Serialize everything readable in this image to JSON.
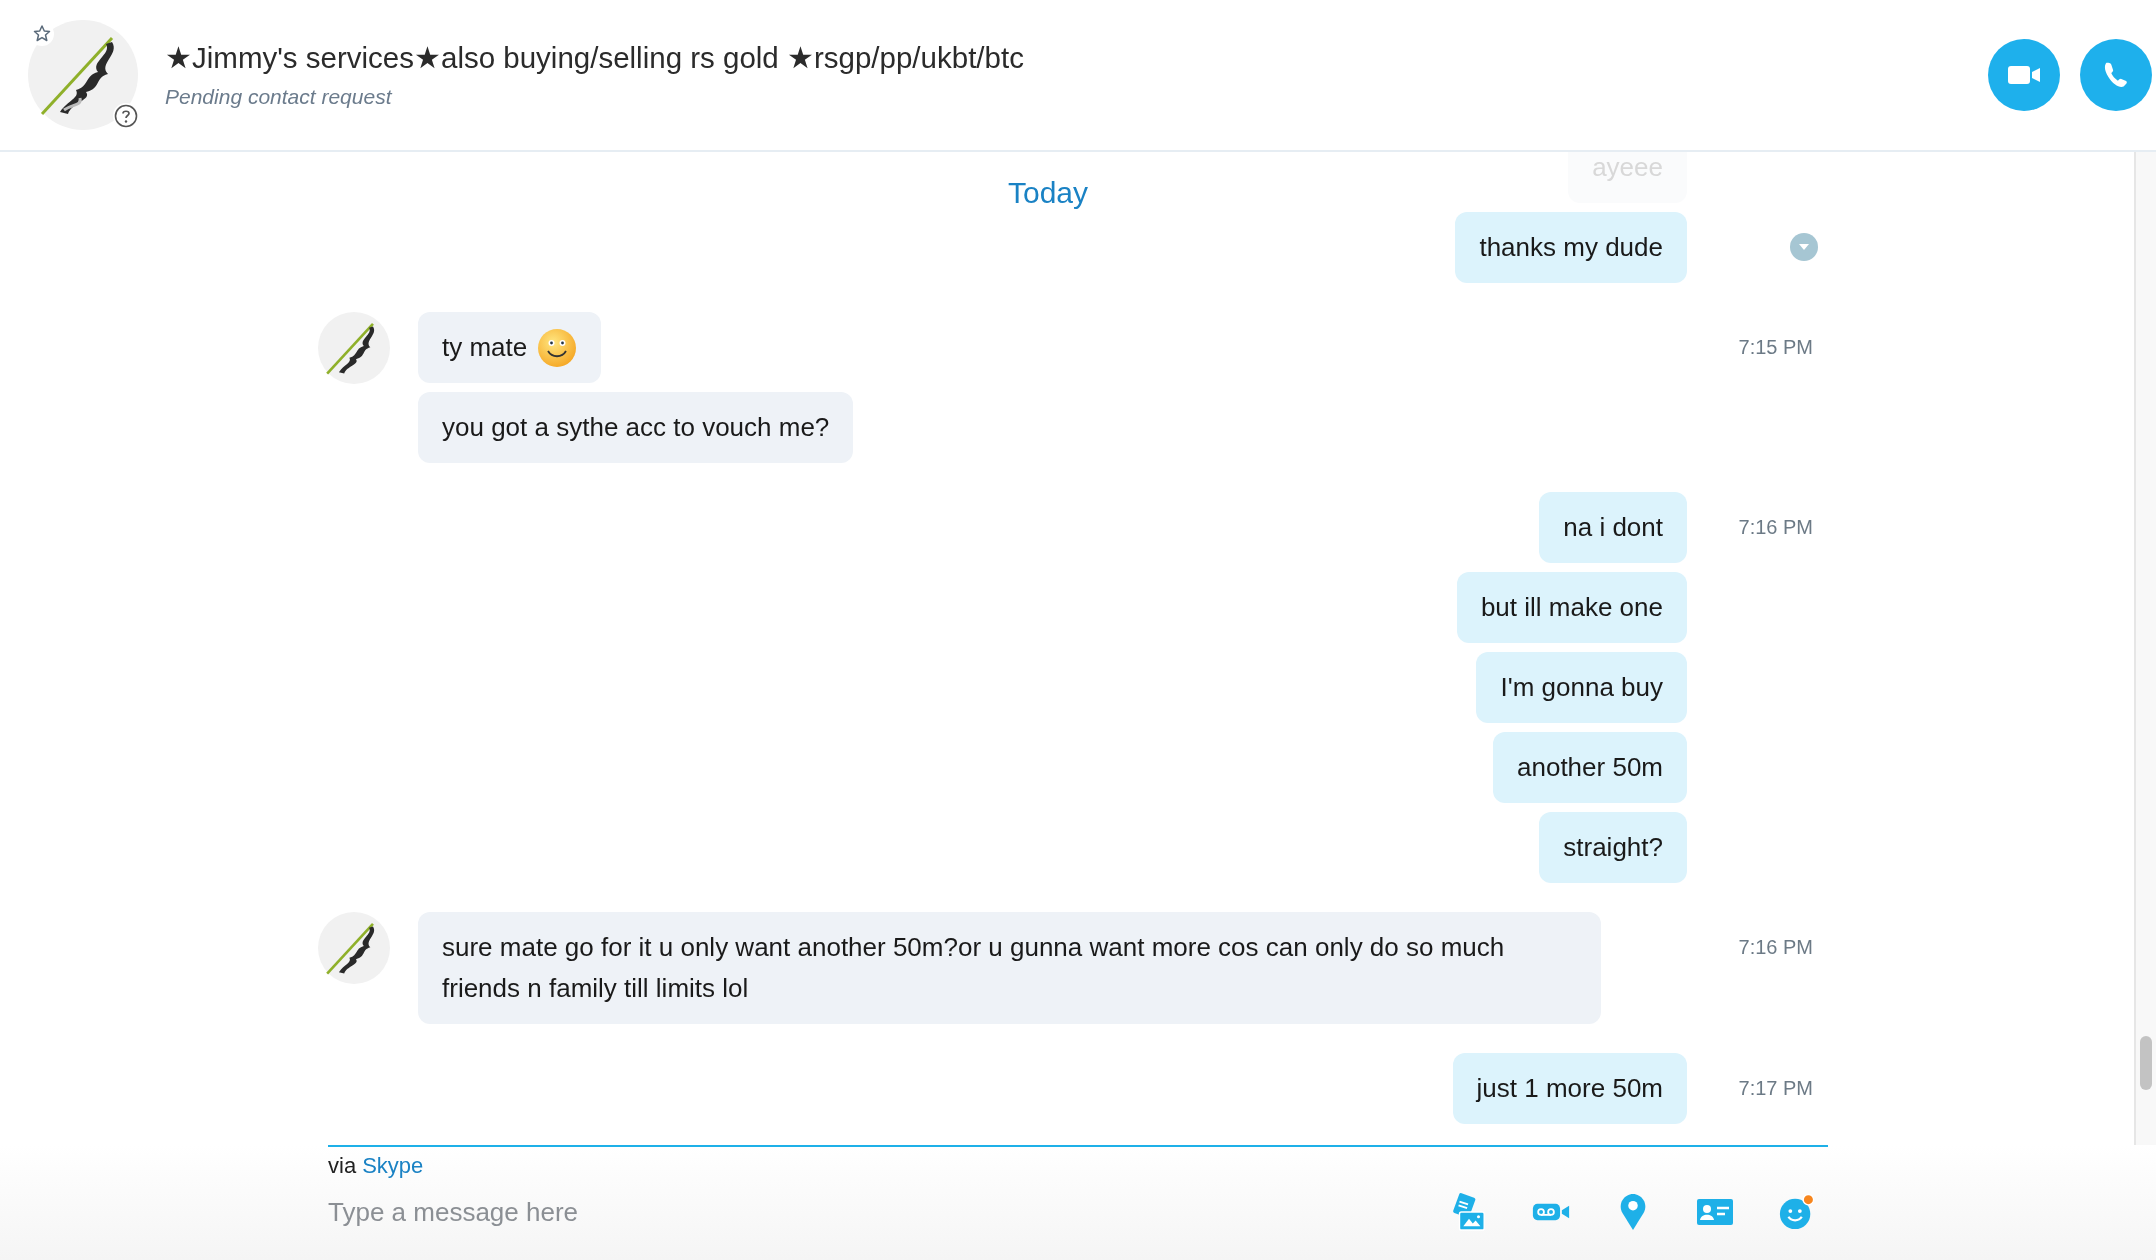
{
  "contact": {
    "name": "★Jimmy's services★also buying/selling rs gold ★rsgp/pp/ukbt/btc",
    "status": "Pending contact request"
  },
  "date_divider": "Today",
  "groups": [
    {
      "kind": "outgoing",
      "messages": [
        {
          "text": "ayeee",
          "faded": true,
          "emoji": false
        },
        {
          "text": "thanks my dude",
          "faded": false,
          "emoji": false
        }
      ]
    },
    {
      "kind": "incoming",
      "time": "7:15 PM",
      "messages": [
        {
          "text": "ty mate",
          "faded": false,
          "emoji": true
        },
        {
          "text": "you got a sythe acc to vouch me?",
          "faded": false,
          "emoji": false
        }
      ]
    },
    {
      "kind": "outgoing",
      "time": "7:16 PM",
      "messages": [
        {
          "text": "na i dont",
          "faded": false,
          "emoji": false
        },
        {
          "text": "but ill make one",
          "faded": false,
          "emoji": false
        },
        {
          "text": "I'm gonna buy",
          "faded": false,
          "emoji": false
        },
        {
          "text": "another 50m",
          "faded": false,
          "emoji": false
        },
        {
          "text": "straight?",
          "faded": false,
          "emoji": false
        }
      ]
    },
    {
      "kind": "incoming",
      "time": "7:16 PM",
      "messages": [
        {
          "text": "sure mate go for it u only want another 50m?or u gunna want more cos can only do so much friends n family till limits lol",
          "faded": false,
          "emoji": false
        }
      ]
    },
    {
      "kind": "outgoing",
      "time": "7:17 PM",
      "messages": [
        {
          "text": "just 1 more 50m",
          "faded": false,
          "emoji": false
        }
      ]
    }
  ],
  "composer": {
    "via_prefix": "via",
    "via_link": "Skype",
    "placeholder": "Type a message here"
  }
}
